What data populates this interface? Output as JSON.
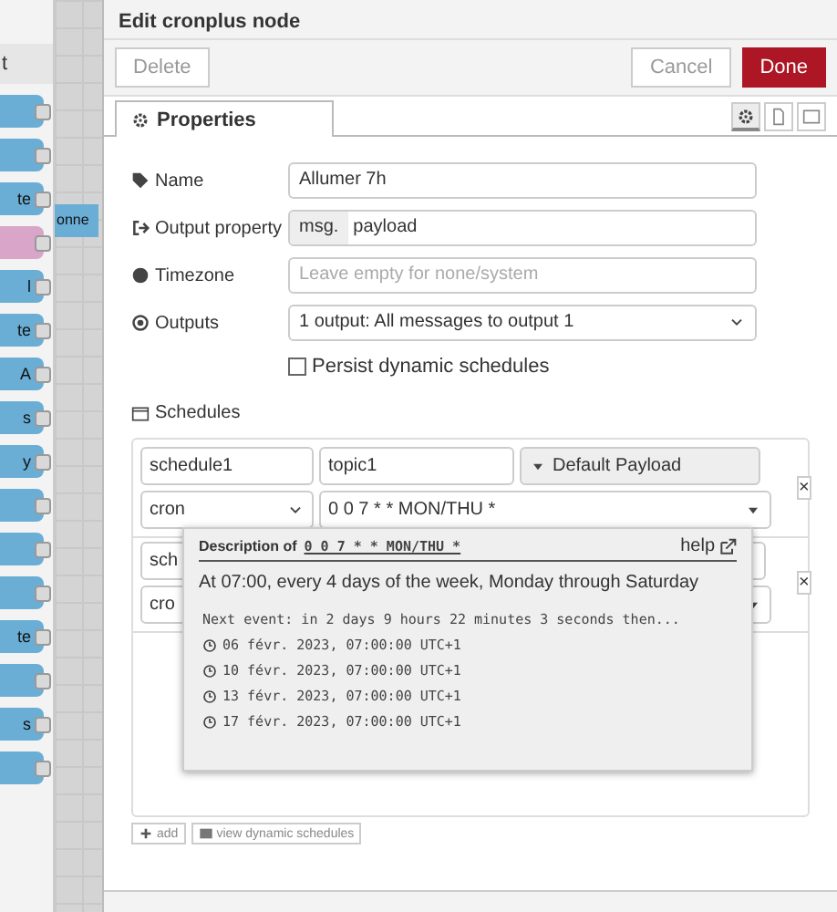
{
  "palette": {
    "header": "t",
    "nodes": [
      {
        "color": "#6aaed6"
      },
      {
        "color": "#6aaed6"
      },
      {
        "label": "te",
        "color": "#6aaed6"
      },
      {
        "color": "#d9a5c9"
      },
      {
        "label": "l",
        "color": "#6aaed6"
      },
      {
        "label": "te",
        "color": "#6aaed6"
      },
      {
        "label": "A",
        "color": "#6aaed6"
      },
      {
        "label": "s",
        "color": "#6aaed6"
      },
      {
        "label": "y",
        "color": "#6aaed6"
      },
      {
        "color": "#6aaed6"
      },
      {
        "color": "#6aaed6"
      },
      {
        "color": "#6aaed6"
      },
      {
        "label": "te",
        "color": "#6aaed6"
      },
      {
        "color": "#6aaed6"
      },
      {
        "label": "s",
        "color": "#6aaed6"
      },
      {
        "color": "#6aaed6"
      }
    ],
    "canvas_fragment": "onne"
  },
  "tray": {
    "title": "Edit cronplus node",
    "buttons": {
      "delete": "Delete",
      "cancel": "Cancel",
      "done": "Done"
    },
    "tabs": [
      {
        "label": "Properties",
        "selected": true
      }
    ],
    "tab_icons": [
      {
        "kind": "gear",
        "selected": true
      },
      {
        "kind": "doc",
        "selected": false
      },
      {
        "kind": "frame",
        "selected": false
      }
    ],
    "fields": [
      {
        "kind": "text",
        "label": "Name",
        "value": "Allumer 7h"
      },
      {
        "kind": "typed",
        "label": "Output property",
        "prefix": "msg.",
        "value": "payload"
      },
      {
        "kind": "text",
        "label": "Timezone",
        "placeholder": "Leave empty for none/system"
      },
      {
        "kind": "select",
        "label": "Outputs",
        "value": "1 output: All messages to output 1"
      }
    ],
    "persist": {
      "label": "Persist dynamic schedules",
      "checked": false
    },
    "schedules_label": "Schedules",
    "schedules": [
      {
        "name": "schedule1",
        "topic": "topic1",
        "payload": "Default Payload",
        "type": "cron",
        "expression": "0 0 7 * * MON/THU *",
        "remove": "×"
      },
      {
        "name": "sch",
        "type": "cro",
        "remove": "×"
      }
    ],
    "popup": {
      "title": "Description of",
      "expression": "0 0 7 * * MON/THU *",
      "help": "help",
      "description": "At 07:00, every 4 days of the week, Monday through Saturday",
      "next": "Next event: in 2 days 9 hours 22 minutes 3 seconds then...",
      "events": [
        "06 févr. 2023, 07:00:00 UTC+1",
        "10 févr. 2023, 07:00:00 UTC+1",
        "13 févr. 2023, 07:00:00 UTC+1",
        "17 févr. 2023, 07:00:00 UTC+1"
      ]
    },
    "footer_buttons": [
      {
        "label": "add"
      },
      {
        "label": "view dynamic schedules"
      }
    ]
  }
}
